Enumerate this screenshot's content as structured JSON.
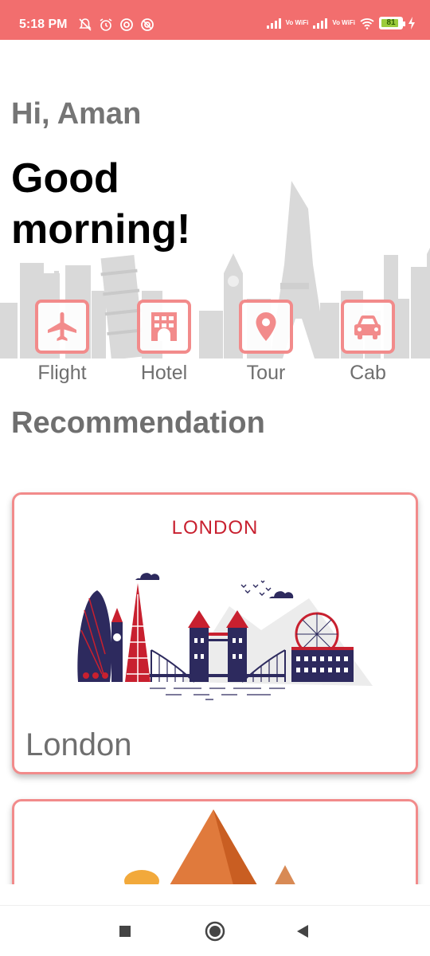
{
  "status_bar": {
    "time": "5:18 PM",
    "battery": "81",
    "left_icons": [
      "mute-bell-icon",
      "alarm-icon",
      "data-saver-icon",
      "dnd-icon"
    ],
    "right_icons": [
      "signal-icon",
      "vowifi-icon",
      "signal-icon",
      "vowifi-icon",
      "wifi-icon",
      "battery-icon",
      "charging-icon"
    ],
    "vowifi_label": "Vo WiFi",
    "color": "#f26e6e"
  },
  "greeting": {
    "hi": "Hi, Aman",
    "message": "Good morning!"
  },
  "categories": [
    {
      "label": "Flight",
      "icon": "airplane-icon"
    },
    {
      "label": "Hotel",
      "icon": "hotel-icon"
    },
    {
      "label": "Tour",
      "icon": "location-pin-icon"
    },
    {
      "label": "Cab",
      "icon": "car-icon"
    }
  ],
  "recommendation": {
    "title": "Recommendation",
    "cards": [
      {
        "heading": "LONDON",
        "name": "London",
        "illustration": "london-skyline"
      },
      {
        "heading": "",
        "name": "",
        "illustration": "egypt-pyramids"
      }
    ]
  },
  "nav": {
    "buttons": [
      "recents-button",
      "home-button",
      "back-button"
    ]
  },
  "colors": {
    "accent": "#f28b8b",
    "text_grey": "#6f6f6f",
    "heading_red": "#c8202f",
    "navy": "#2d2a5e"
  }
}
